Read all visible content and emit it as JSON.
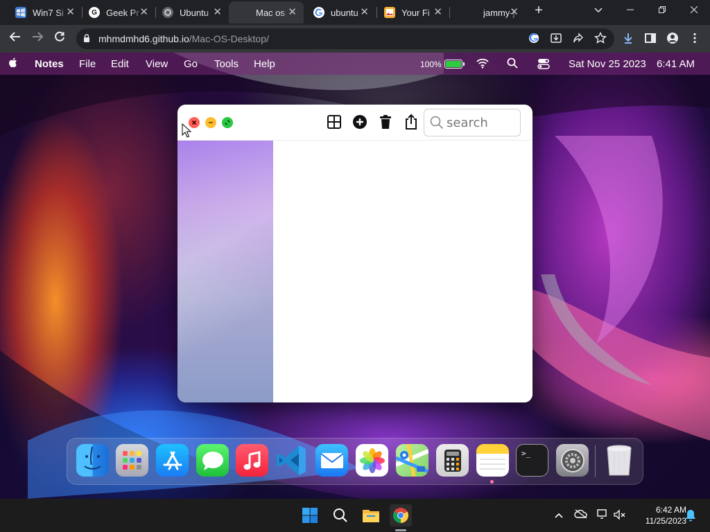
{
  "browser": {
    "tabs": [
      {
        "title": "Win7 Si",
        "favicon": "win7-favicon",
        "active": false
      },
      {
        "title": "Geek Pr",
        "favicon": "geek-favicon",
        "active": false
      },
      {
        "title": "Ubuntu",
        "favicon": "ubuntu-favicon",
        "active": false
      },
      {
        "title": "Mac os",
        "favicon": "apple-favicon",
        "active": true
      },
      {
        "title": "ubuntu",
        "favicon": "google-favicon",
        "active": false
      },
      {
        "title": "Your Fi",
        "favicon": "image-favicon",
        "active": false
      },
      {
        "title": "jammy-j",
        "favicon": "blank-favicon",
        "active": false
      }
    ],
    "new_tab_label": "+",
    "url_host": "mhmdmhd6.github.io",
    "url_path": "/Mac-OS-Desktop/"
  },
  "mac": {
    "menubar": {
      "app_name": "Notes",
      "menus": [
        "File",
        "Edit",
        "View",
        "Go",
        "Tools",
        "Help"
      ],
      "battery_percent_text": "100%",
      "battery_level": 1.0,
      "date": "Sat Nov 25 2023",
      "time": "6:41 AM"
    },
    "notes_window": {
      "search_placeholder": "search",
      "toolbar_icons": [
        "grid-icon",
        "add-circle-icon",
        "trash-icon",
        "share-icon"
      ]
    },
    "dock": {
      "apps": [
        "Finder",
        "Launchpad",
        "App Store",
        "Messages",
        "Music",
        "VS Code",
        "Mail",
        "Photos",
        "Maps",
        "Calculator",
        "Notes",
        "Terminal",
        "System Preferences",
        "Trash"
      ],
      "running_app": "Notes",
      "terminal_prompt": ">_"
    }
  },
  "windows": {
    "clock_time": "6:42 AM",
    "clock_date": "11/25/2023"
  },
  "colors": {
    "close": "#ff5f57",
    "minimize": "#febc2e",
    "maximize": "#28c840",
    "battery": "#2ecc40"
  }
}
